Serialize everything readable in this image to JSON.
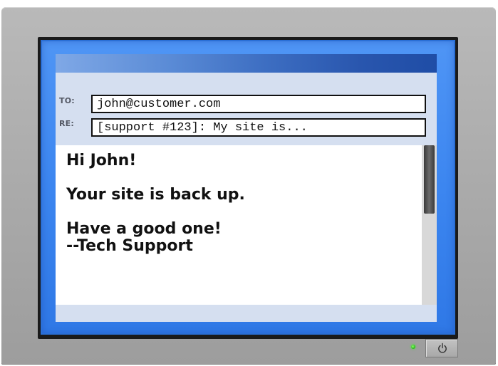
{
  "email": {
    "to_label": "TO:",
    "to_value": "john@customer.com",
    "re_label": "RE:",
    "re_value": "[support #123]: My site is..."
  },
  "message": {
    "line1": "Hi John!",
    "line2": "Your site is back up.",
    "line3": "Have a good one!",
    "line4": "--Tech Support"
  },
  "scroll": {
    "position_fraction": 0.0,
    "visible_fraction": 0.43
  },
  "colors": {
    "screen_frame": "#3c86f0",
    "title_bar": "#2956ae",
    "led": "#2fbf20",
    "monitor_body": "#a9a9a9"
  },
  "icons": {
    "power": "power-icon",
    "led": "power-led-indicator"
  }
}
